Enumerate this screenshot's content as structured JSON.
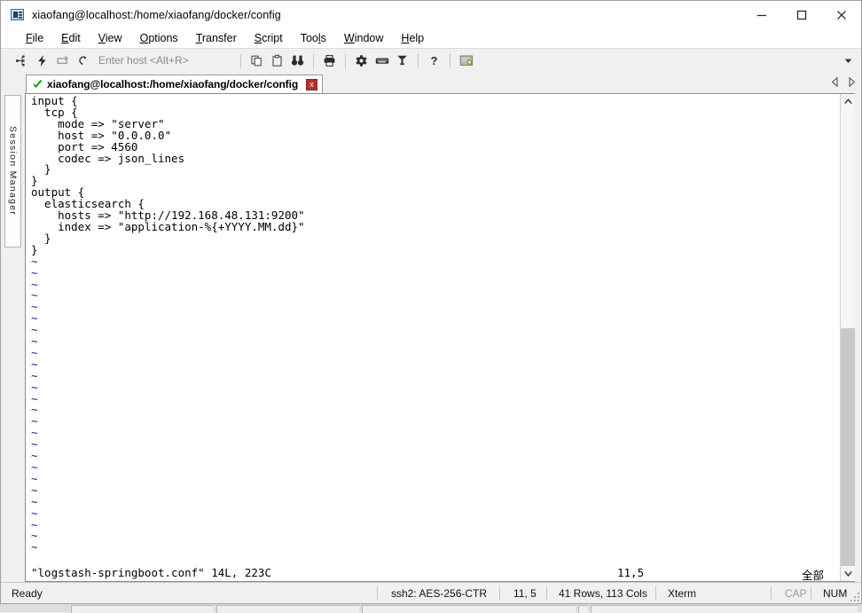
{
  "window": {
    "title": "xiaofang@localhost:/home/xiaofang/docker/config",
    "icon": "securecrt-icon",
    "minimize_label": "—",
    "maximize_label": "□",
    "close_label": "✕"
  },
  "menubar": {
    "items": [
      {
        "label": "File",
        "mnemonic": "F"
      },
      {
        "label": "Edit",
        "mnemonic": "E"
      },
      {
        "label": "View",
        "mnemonic": "V"
      },
      {
        "label": "Options",
        "mnemonic": "O"
      },
      {
        "label": "Transfer",
        "mnemonic": "T"
      },
      {
        "label": "Script",
        "mnemonic": "S"
      },
      {
        "label": "Tools",
        "mnemonic": "l"
      },
      {
        "label": "Window",
        "mnemonic": "W"
      },
      {
        "label": "Help",
        "mnemonic": "H"
      }
    ]
  },
  "toolbar": {
    "host_placeholder": "Enter host <Alt+R>",
    "buttons": [
      {
        "name": "connect-icon",
        "tip": "Connect"
      },
      {
        "name": "quick-connect-icon",
        "tip": "Quick Connect"
      },
      {
        "name": "reconnect-all-icon",
        "tip": "Reconnect All"
      },
      {
        "name": "reconnect-icon",
        "tip": "Reconnect"
      },
      {
        "name": "copy-icon",
        "tip": "Copy"
      },
      {
        "name": "paste-icon",
        "tip": "Paste"
      },
      {
        "name": "find-icon",
        "tip": "Find"
      },
      {
        "name": "print-icon",
        "tip": "Print"
      },
      {
        "name": "settings-gear-icon",
        "tip": "Session Options"
      },
      {
        "name": "keyboard-icon",
        "tip": "Keymap Editor"
      },
      {
        "name": "key-icon",
        "tip": "Public Key"
      },
      {
        "name": "help-icon",
        "tip": "Help"
      },
      {
        "name": "screen-capture-icon",
        "tip": "Capture"
      }
    ],
    "overflow_label": "▼"
  },
  "tabbar": {
    "tabs": [
      {
        "label": "xiaofang@localhost:/home/xiaofang/docker/config",
        "status": "connected",
        "close_label": "x"
      }
    ],
    "nav_prev": "◁",
    "nav_next": "▷"
  },
  "sidebar": {
    "vertical_tab_label": "Session Manager"
  },
  "terminal": {
    "content_lines": [
      "input {",
      "  tcp {",
      "    mode => \"server\"",
      "    host => \"0.0.0.0\"",
      "    port => 4560",
      "    codec => json_lines",
      "  }",
      "}",
      "output {",
      "  elasticsearch {",
      "    hosts => \"http://192.168.48.131:9200\"",
      "    index => \"application-%{+YYYY.MM.dd}\"",
      "  }",
      "}"
    ],
    "empty_line_marker": "~",
    "empty_line_count": 26,
    "vim_status": {
      "file": "\"logstash-springboot.conf\" 14L, 223C",
      "position": "11,5",
      "scroll_indicator": "全部"
    }
  },
  "statusbar": {
    "state": "Ready",
    "encryption": "ssh2: AES-256-CTR",
    "cursor": "11,  5",
    "dimensions": "41 Rows, 113 Cols",
    "emulation": "Xterm",
    "caps_lock": "CAP",
    "num_lock": "NUM"
  },
  "colors": {
    "accent_green": "#12a012",
    "close_red": "#b03030",
    "tilde_blue": "#1a1a8c",
    "chrome": "#f0f0f0"
  }
}
